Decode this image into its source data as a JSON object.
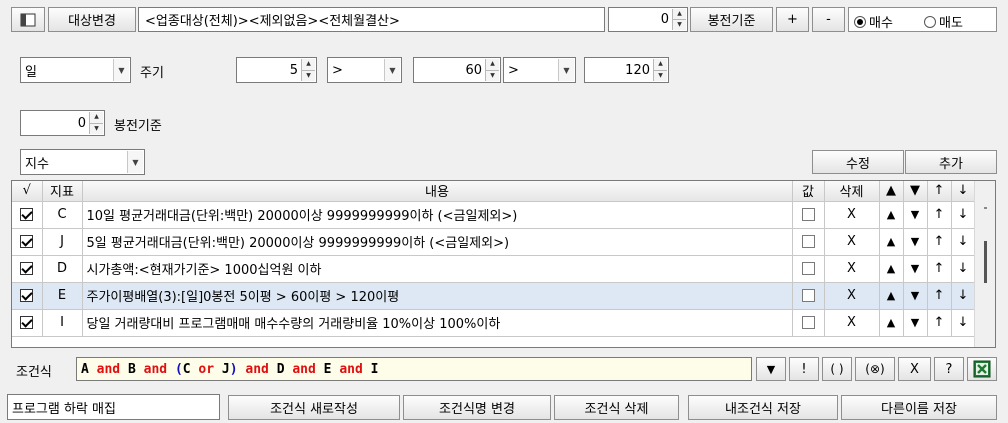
{
  "top": {
    "change_target_label": "대상변경",
    "target_text": "<업종대상(전체)><제외없음><전체월결산>",
    "bong_value": "0",
    "bong_label": "봉전기준",
    "plus_label": "+",
    "minus_label": "-",
    "buy_label": "매수",
    "sell_label": "매도",
    "buy_selected": true
  },
  "settings": {
    "period_select": "일",
    "period_label": "주기",
    "ma1": "5",
    "op1": ">",
    "ma2": "60",
    "op2": ">",
    "ma3": "120",
    "bong_value": "0",
    "bong_label": "봉전기준",
    "index_select": "지수",
    "modify_label": "수정",
    "add_label": "추가"
  },
  "grid": {
    "headers": [
      "√",
      "지표",
      "내용",
      "값",
      "삭제",
      "▲",
      "▼",
      "↑",
      "↓"
    ],
    "rows": [
      {
        "code": "C",
        "content": "10일 평균거래대금(단위:백만) 20000이상 9999999999이하 (<금일제외>)",
        "checked": true
      },
      {
        "code": "J",
        "content": "5일 평균거래대금(단위:백만) 20000이상 9999999999이하 (<금일제외>)",
        "checked": true
      },
      {
        "code": "D",
        "content": "시가총액:<현재가기준> 1000십억원 이하",
        "checked": true
      },
      {
        "code": "E",
        "content": "주가이평배열(3):[일]0봉전 5이평 > 60이평 > 120이평",
        "checked": true,
        "selected": true
      },
      {
        "code": "I",
        "content": "당일 거래량대비 프로그램매매 매수수량의 거래량비율 10%이상 100%이하",
        "checked": true
      }
    ],
    "delete_mark": "X",
    "up_mark": "▲",
    "down_mark": "▼",
    "top_mark": "↑",
    "bottom_mark": "↓"
  },
  "formula": {
    "label": "조건식",
    "tokens": [
      {
        "t": "A",
        "color": "#000000"
      },
      {
        "t": " and ",
        "color": "#e01010"
      },
      {
        "t": "B",
        "color": "#000000"
      },
      {
        "t": " and ",
        "color": "#e01010"
      },
      {
        "t": "(",
        "color": "#1010c0"
      },
      {
        "t": "C",
        "color": "#000000"
      },
      {
        "t": " or ",
        "color": "#e01010"
      },
      {
        "t": "J",
        "color": "#000000"
      },
      {
        "t": ")",
        "color": "#1010c0"
      },
      {
        "t": " and ",
        "color": "#e01010"
      },
      {
        "t": "D",
        "color": "#000000"
      },
      {
        "t": " and ",
        "color": "#e01010"
      },
      {
        "t": "E",
        "color": "#000000"
      },
      {
        "t": " and ",
        "color": "#e01010"
      },
      {
        "t": "I",
        "color": "#000000"
      }
    ],
    "btn_down": "▼",
    "btn_not": "!",
    "btn_paren": "( )",
    "btn_circle": "(⊗)",
    "btn_x": "X",
    "btn_help": "?"
  },
  "bottom": {
    "name_value": "프로그램 하락 매집",
    "new_label": "조건식 새로작성",
    "rename_label": "조건식명 변경",
    "delete_label": "조건식 삭제",
    "save_label": "내조건식 저장",
    "save_as_label": "다른이름 저장"
  },
  "colors": {
    "selected_row": "#dde8f4",
    "formula_bg": "#fdfde9",
    "excel_green": "#1e7a34"
  }
}
